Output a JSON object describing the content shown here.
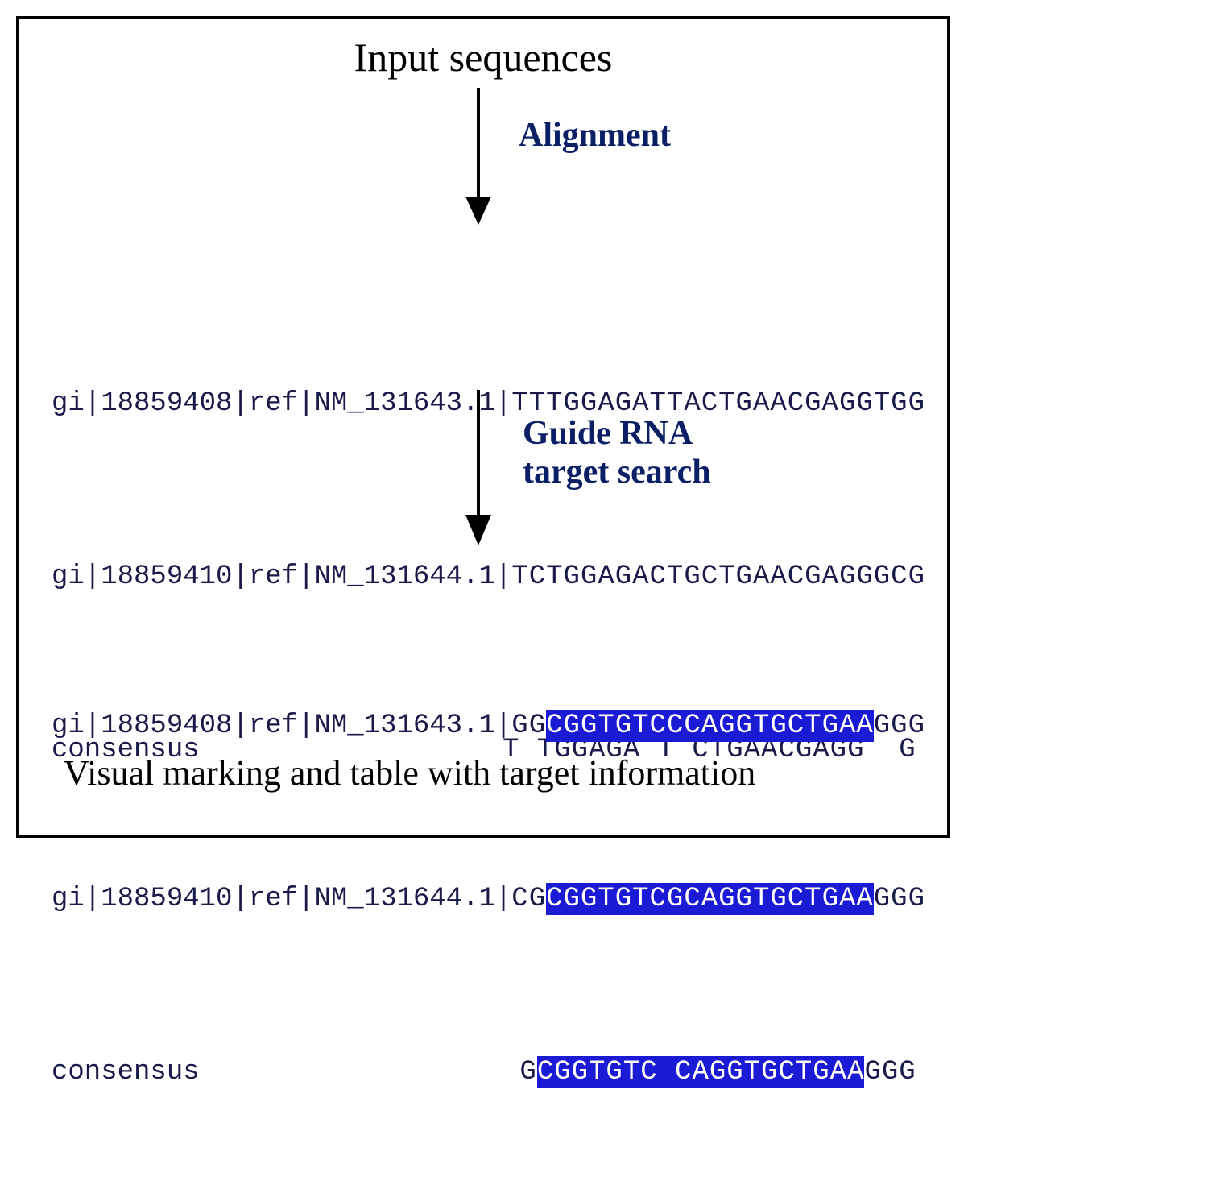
{
  "title": "Input sequences",
  "step1_label": "Alignment",
  "step2_label_line1": "Guide RNA",
  "step2_label_line2": "target search",
  "caption": "Visual marking and table with target information",
  "alignment_block": {
    "rows": [
      {
        "label": "gi|18859408|ref|NM_131643.1|",
        "seq": "TTTGGAGATTACTGAACGAGGTGG"
      },
      {
        "label": "gi|18859410|ref|NM_131644.1|",
        "seq": "TCTGGAGACTGCTGAACGAGGGCG"
      },
      {
        "label": "consensus",
        "seq": "T TGGAGA T CTGAACGAGG  G"
      }
    ]
  },
  "target_block": {
    "rows": [
      {
        "label": "gi|18859408|ref|NM_131643.1|",
        "pre": "GG",
        "hl": "CGGTGTCCCAGGTGCTGAA",
        "post": "GGG"
      },
      {
        "label": "gi|18859410|ref|NM_131644.1|",
        "pre": "CG",
        "hl": "CGGTGTCGCAGGTGCTGAA",
        "post": "GGG"
      },
      {
        "label": "consensus",
        "pre": " G",
        "hl": "CGGTGTC CAGGTGCTGAA",
        "post": "GGG"
      }
    ]
  }
}
